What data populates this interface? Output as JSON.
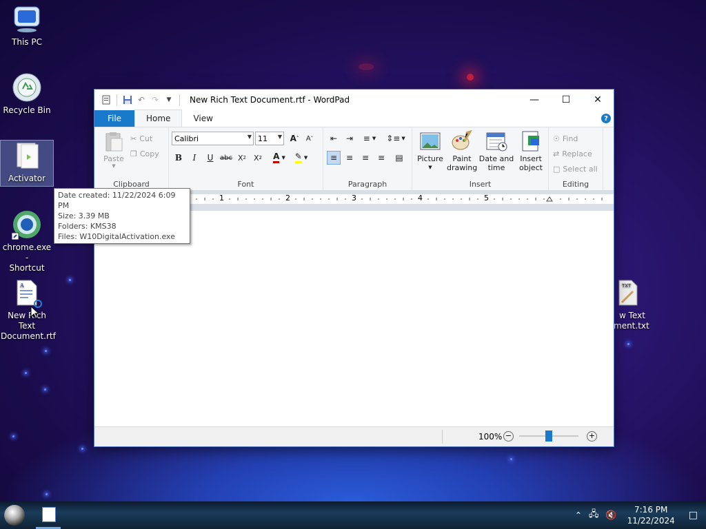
{
  "desktop": {
    "icons": [
      {
        "label_line1": "This PC",
        "label_line2": ""
      },
      {
        "label_line1": "Recycle Bin",
        "label_line2": ""
      },
      {
        "label_line1": "Activator",
        "label_line2": ""
      },
      {
        "label_line1": "chrome.exe -",
        "label_line2": "Shortcut"
      },
      {
        "label_line1": "New Rich Text",
        "label_line2": "Document.rtf"
      },
      {
        "label_line1": "w Text",
        "label_line2": "ment.txt"
      }
    ],
    "tooltip": {
      "date_created": "Date created: 11/22/2024 6:09 PM",
      "size": "Size: 3.39 MB",
      "folders": "Folders: KMS38",
      "files": "Files: W10DigitalActivation.exe"
    }
  },
  "window": {
    "title": "New Rich Text Document.rtf - WordPad",
    "tabs": {
      "file": "File",
      "home": "Home",
      "view": "View"
    },
    "help": "?",
    "clipboard": {
      "paste": "Paste",
      "cut": "Cut",
      "copy": "Copy",
      "label": "Clipboard"
    },
    "font": {
      "family": "Calibri",
      "size": "11",
      "label": "Font"
    },
    "paragraph": {
      "label": "Paragraph"
    },
    "insert": {
      "picture": "Picture",
      "paint_line1": "Paint",
      "paint_line2": "drawing",
      "datetime_line1": "Date and",
      "datetime_line2": "time",
      "object_line1": "Insert",
      "object_line2": "object",
      "label": "Insert"
    },
    "editing": {
      "find": "Find",
      "replace": "Replace",
      "select_all": "Select all",
      "label": "Editing"
    },
    "ruler": {
      "numbers": [
        "1",
        "2",
        "3",
        "4",
        "5"
      ]
    },
    "status": {
      "zoom": "100%",
      "zoom_level": 0.5
    }
  },
  "taskbar": {
    "time": "7:16 PM",
    "date": "11/22/2024"
  }
}
